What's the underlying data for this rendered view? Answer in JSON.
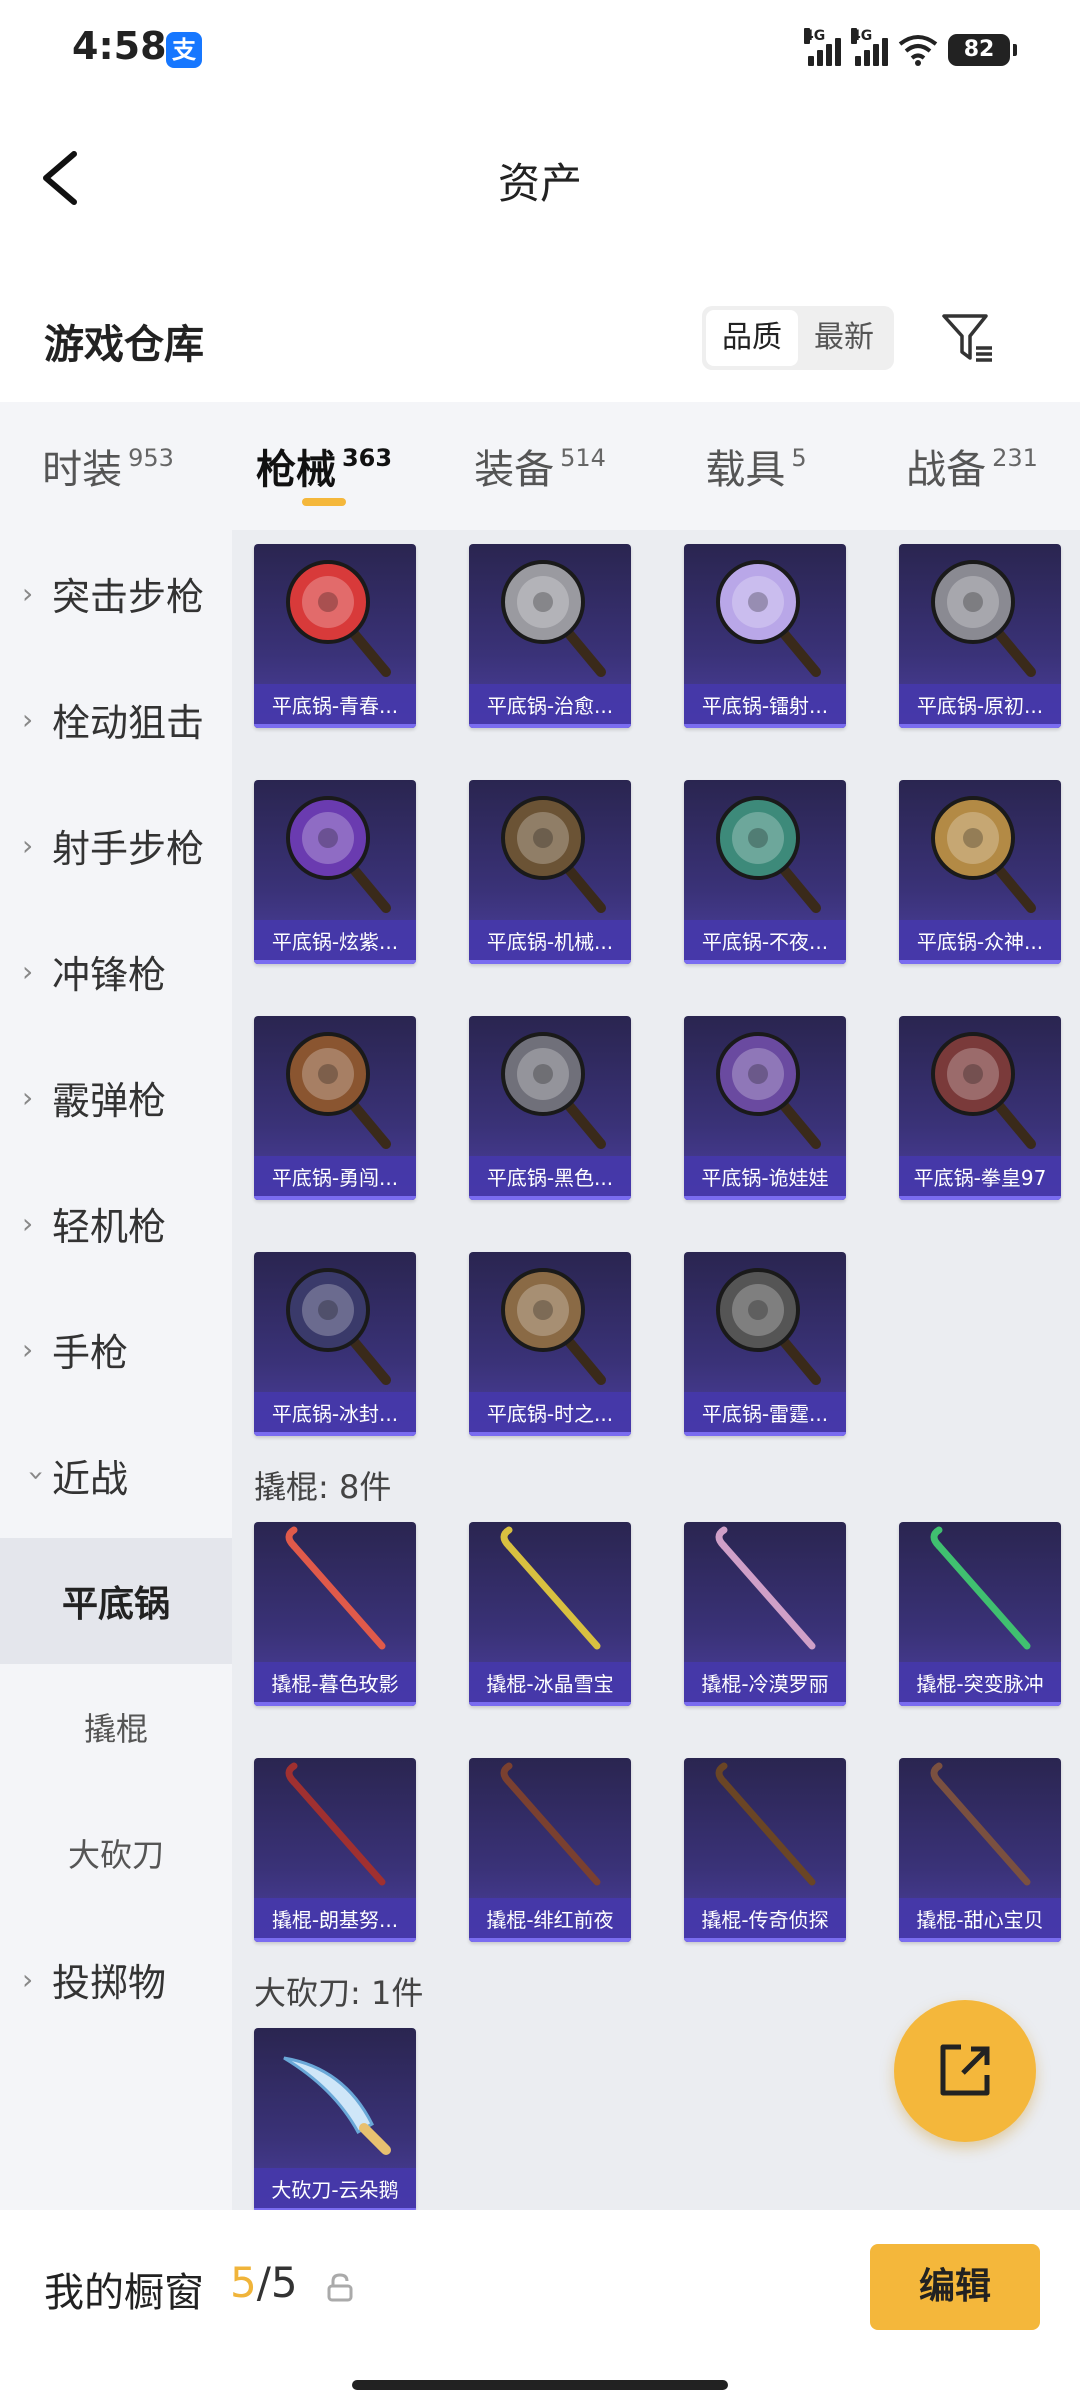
{
  "status_bar": {
    "time": "4:58",
    "app_badge": "支",
    "network_1": "4G",
    "network_2": "4G",
    "battery": "82"
  },
  "nav": {
    "title": "资产"
  },
  "section": {
    "title": "游戏仓库",
    "sort_options": [
      "品质",
      "最新"
    ],
    "sort_active": "品质"
  },
  "tabs": [
    {
      "label": "时装",
      "count": "953",
      "active": false
    },
    {
      "label": "枪械",
      "count": "363",
      "active": true
    },
    {
      "label": "装备",
      "count": "514",
      "active": false
    },
    {
      "label": "载具",
      "count": "5",
      "active": false
    },
    {
      "label": "战备",
      "count": "231",
      "active": false
    }
  ],
  "sidebar": {
    "items": [
      {
        "label": "突击步枪",
        "icon": "chevron-right-icon"
      },
      {
        "label": "栓动狙击",
        "icon": "chevron-right-icon"
      },
      {
        "label": "射手步枪",
        "icon": "chevron-right-icon"
      },
      {
        "label": "冲锋枪",
        "icon": "chevron-right-icon"
      },
      {
        "label": "霰弹枪",
        "icon": "chevron-right-icon"
      },
      {
        "label": "轻机枪",
        "icon": "chevron-right-icon"
      },
      {
        "label": "手枪",
        "icon": "chevron-right-icon"
      },
      {
        "label": "近战",
        "icon": "chevron-down-icon"
      }
    ],
    "sub_items": [
      {
        "label": "平底锅",
        "selected": true
      },
      {
        "label": "撬棍",
        "selected": false
      },
      {
        "label": "大砍刀",
        "selected": false
      }
    ],
    "last_item": {
      "label": "投掷物",
      "icon": "chevron-right-icon"
    }
  },
  "groups": {
    "pan": {
      "items": [
        "平底锅-青春...",
        "平底锅-治愈...",
        "平底锅-镭射...",
        "平底锅-原初...",
        "平底锅-炫紫...",
        "平底锅-机械...",
        "平底锅-不夜...",
        "平底锅-众神...",
        "平底锅-勇闯...",
        "平底锅-黑色...",
        "平底锅-诡娃娃",
        "平底锅-拳皇97",
        "平底锅-冰封...",
        "平底锅-时之...",
        "平底锅-雷霆..."
      ]
    },
    "crowbar": {
      "title": "撬棍: 8件",
      "items": [
        "撬棍-暮色玫影",
        "撬棍-冰晶雪宝",
        "撬棍-冷漠罗丽",
        "撬棍-突变脉冲",
        "撬棍-朗基努...",
        "撬棍-绯红前夜",
        "撬棍-传奇侦探",
        "撬棍-甜心宝贝"
      ]
    },
    "machete": {
      "title": "大砍刀: 1件",
      "items": [
        "大砍刀-云朵鹅"
      ]
    }
  },
  "bottom": {
    "label": "我的橱窗",
    "current": "5",
    "separator": "/",
    "total": "5",
    "edit": "编辑"
  },
  "colors": {
    "accent": "#f4b73b",
    "card_bg": "#3a3278",
    "caption_bg": "#4638aa"
  }
}
